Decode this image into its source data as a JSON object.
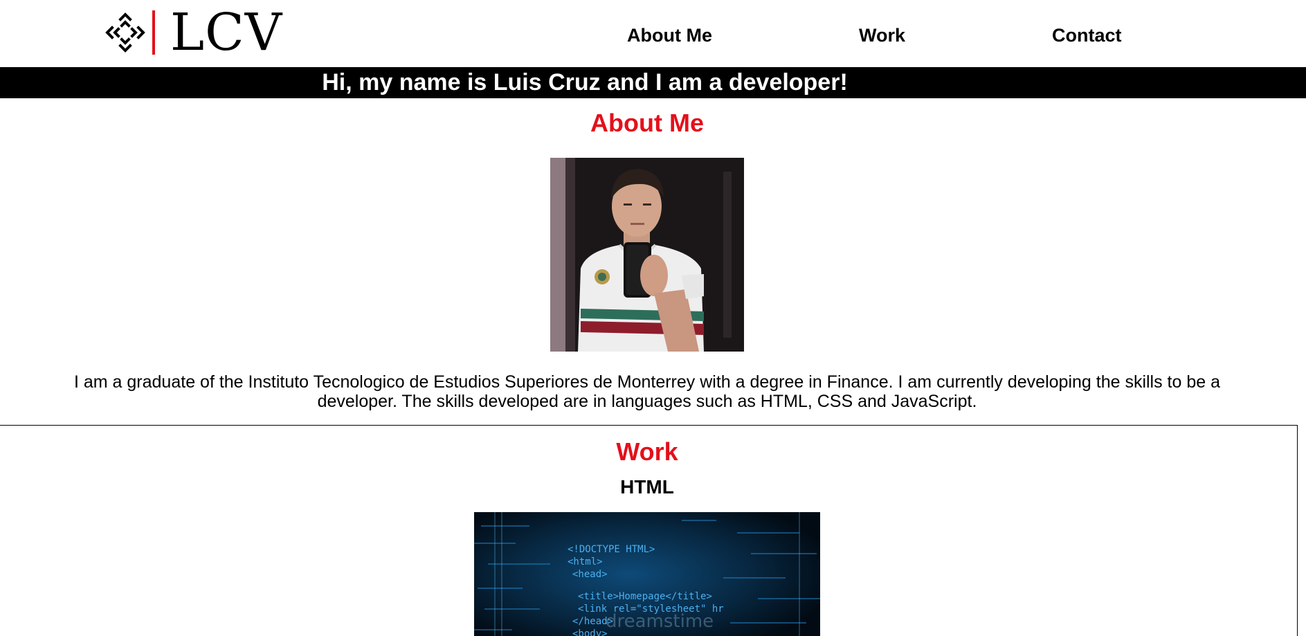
{
  "header": {
    "logo_text": "LCV",
    "nav": [
      {
        "label": "About Me"
      },
      {
        "label": "Work"
      },
      {
        "label": "Contact"
      }
    ]
  },
  "banner": {
    "text": "Hi, my name is Luis Cruz and I am a developer!"
  },
  "about": {
    "title": "About Me",
    "bio": "I am a graduate of the Instituto Tecnologico de Estudios Superiores de Monterrey with a degree in Finance. I am currently developing the skills to be a developer. The skills developed are in languages such as HTML, CSS and JavaScript."
  },
  "work": {
    "title": "Work",
    "projects": [
      {
        "name": "HTML",
        "image_code_lines": [
          "<!DOCTYPE HTML>",
          "<html>",
          "<head>",
          "<title>Homepage</title>",
          "<link rel=\"stylesheet\" hr",
          "</head>",
          "<body>"
        ],
        "image_watermark": "dreamstime"
      }
    ]
  },
  "colors": {
    "accent": "#e3101b",
    "banner_bg": "#000000",
    "banner_text": "#ffffff",
    "text": "#000000",
    "code_blue": "#4ab0f0"
  }
}
